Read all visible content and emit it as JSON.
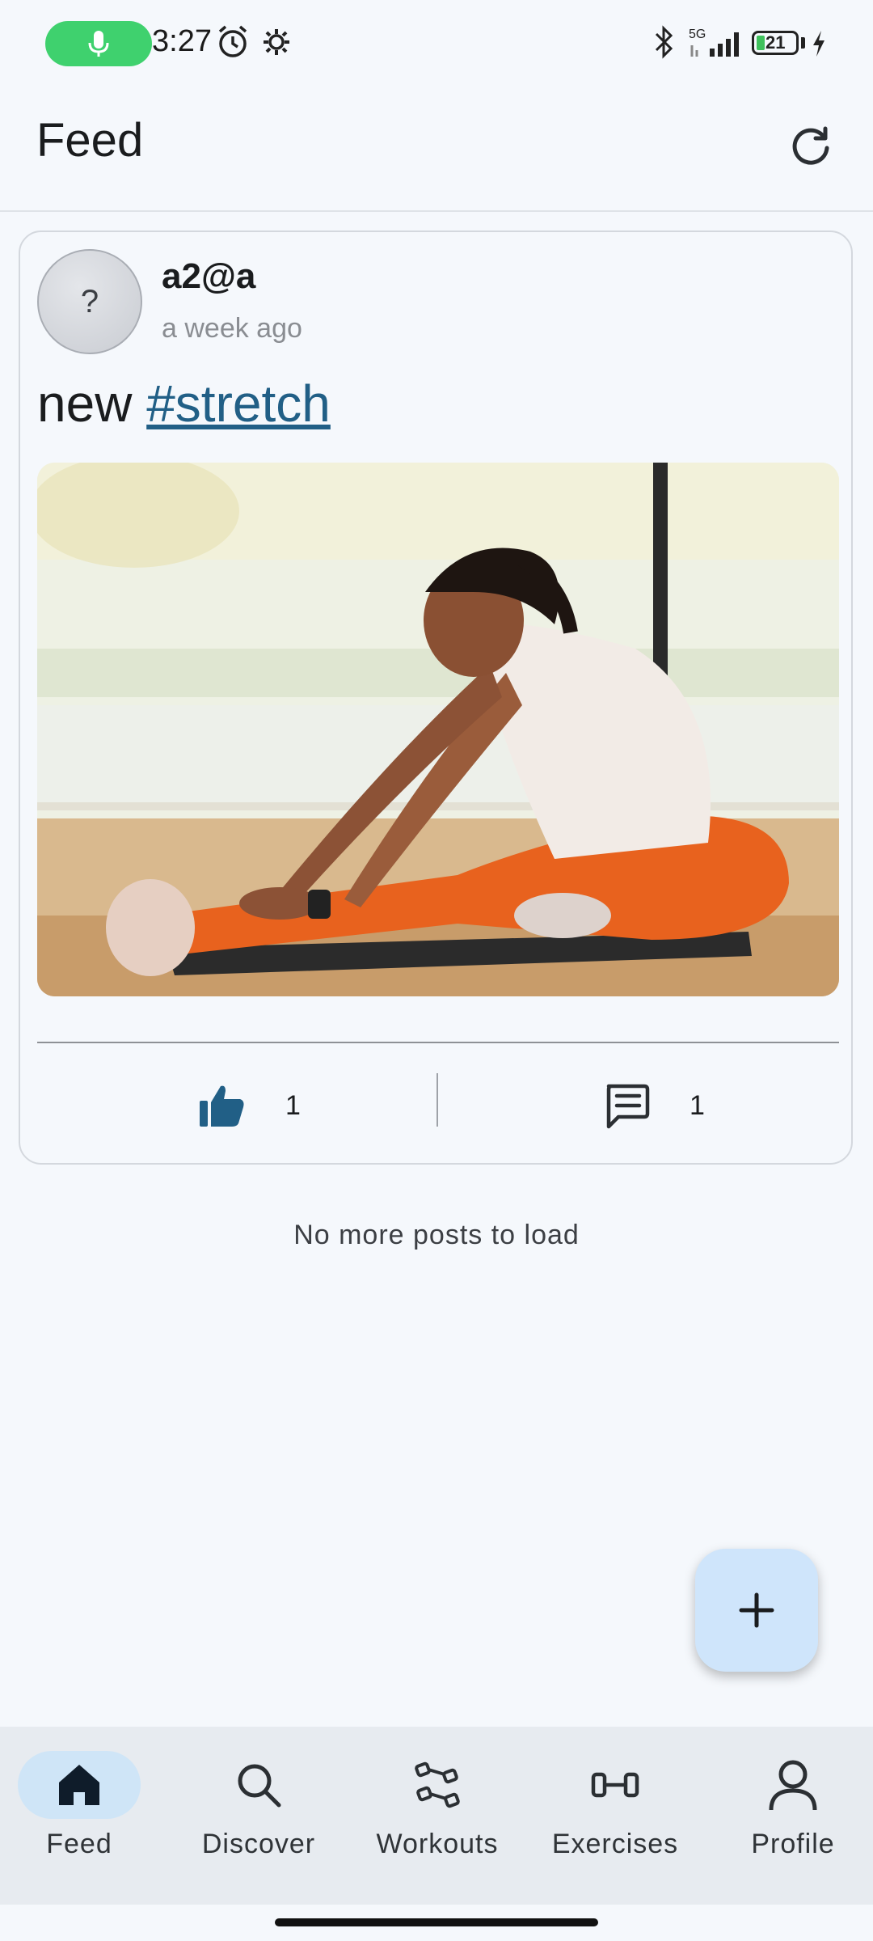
{
  "status_bar": {
    "time": "3:27",
    "network": "5G",
    "battery": "21",
    "icons": [
      "mic-icon",
      "alarm-icon",
      "settings-icon",
      "bluetooth-icon",
      "signal-icon",
      "battery-icon",
      "charging-icon"
    ]
  },
  "app_bar": {
    "title": "Feed",
    "refresh_icon": "refresh-icon"
  },
  "post": {
    "avatar_placeholder": "?",
    "author": "a2@a",
    "time_ago": "a week ago",
    "text": "new",
    "hashtag": "#stretch",
    "image_description_icon": "photo",
    "likes": "1",
    "comments": "1"
  },
  "feed_footer": {
    "no_more": "No more posts to load"
  },
  "fab": {
    "icon": "plus-icon"
  },
  "bottom_nav": {
    "items": [
      {
        "label": "Feed",
        "icon": "home-icon",
        "active": true
      },
      {
        "label": "Discover",
        "icon": "search-icon",
        "active": false
      },
      {
        "label": "Workouts",
        "icon": "dumbbell-icon",
        "active": false
      },
      {
        "label": "Exercises",
        "icon": "barbell-icon",
        "active": false
      },
      {
        "label": "Profile",
        "icon": "person-icon",
        "active": false
      }
    ]
  },
  "colors": {
    "background": "#f5f8fc",
    "accent": "#215f86",
    "fab": "#cfe5fb",
    "nav_active": "#cfe5f7",
    "mic_pill": "#3fd16e"
  }
}
